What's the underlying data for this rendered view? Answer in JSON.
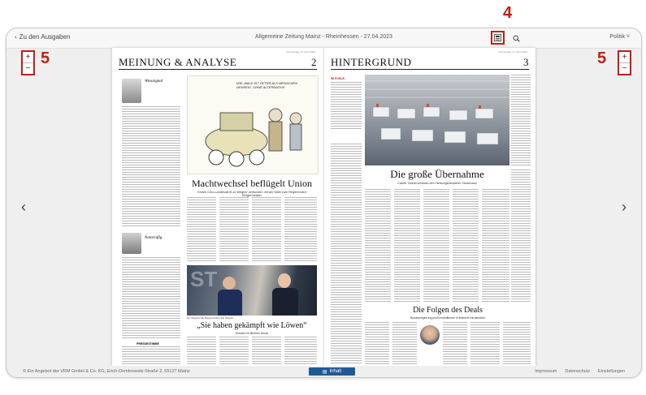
{
  "nav": {
    "back_label": "Zu den Ausgaben",
    "edition_title": "Allgemeine Zeitung Mainz - Rheinhessen - 27.04.2023",
    "section_label": "Politik",
    "toc_icon": "table-of-contents-icon",
    "search_icon": "search-icon"
  },
  "annotations": {
    "label_4": "4",
    "label_5_left": "5",
    "label_5_right": "5",
    "accent_color": "#c41e12"
  },
  "zoom": {
    "in_label": "+",
    "out_label": "−"
  },
  "pages": {
    "left": {
      "header": "MEINUNG & ANALYSE",
      "number": "2",
      "date_line": "Donnerstag, 27. April 2023",
      "cartoon_text": "WIE „BALD IST ÖFTER ALS MENSCHEN DENKEN“, OHNE ALTERNATIVE",
      "headline": "Machtwechsel beflügelt Union",
      "subhead": "Erstes CDU-Landesrat fit zu Wegner verbunden mit der Wahl zum Regierenden Bürgermeister",
      "photo_caption": "Der Regierende Bürgermeister Kai Wegner",
      "quote_headline": "„Sie haben gekämpft wie Löwen“",
      "quote_sub": "Einsicht im Berliner Senat",
      "section_a": "Wiesoignal",
      "section_b": "Notarrufig",
      "section_c": "PRESSESTIMME"
    },
    "right": {
      "header": "HINTERGRUND",
      "number": "3",
      "date_line": "Donnerstag, 27. April 2023",
      "headline": "Die große Übernahme",
      "subhead": "Carrier Global schluckt den Heizungshersteller Viessmann",
      "headline2": "Die Folgen des Deals",
      "subhead2": "Bundesregierung prüft Investitionen in kritische Infrastruktur",
      "side_label": "IM FOKUS"
    }
  },
  "footer": {
    "copyright": "© Ein Angebot der VRM GmbH & Co. KG, Erich-Dombrowski-Straße 2, 55127 Mainz",
    "inhalt_label": "Inhalt",
    "links": [
      "Impressum",
      "Datenschutz",
      "Einstellungen"
    ]
  }
}
